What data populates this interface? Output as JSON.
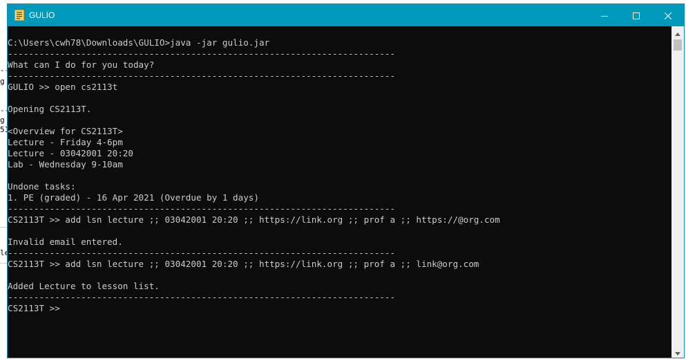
{
  "window": {
    "title": "GULIO"
  },
  "background_fragments": [
    "--",
    "g",
    "--",
    "g",
    "51",
    "le"
  ],
  "console": {
    "lines": [
      "C:\\Users\\cwh78\\Downloads\\GULIO>java -jar gulio.jar",
      "--------------------------------------------------------------------------",
      "What can I do for you today?",
      "--------------------------------------------------------------------------",
      "GULIO >> open cs2113t",
      "",
      "Opening CS2113T.",
      "",
      "<Overview for CS2113T>",
      "Lecture - Friday 4-6pm",
      "Lecture - 03042001 20:20",
      "Lab - Wednesday 9-10am",
      "",
      "Undone tasks:",
      "1. PE (graded) - 16 Apr 2021 (Overdue by 1 days)",
      "--------------------------------------------------------------------------",
      "CS2113T >> add lsn lecture ;; 03042001 20:20 ;; https://link.org ;; prof a ;; https://@org.com",
      "",
      "Invalid email entered.",
      "--------------------------------------------------------------------------",
      "CS2113T >> add lsn lecture ;; 03042001 20:20 ;; https://link.org ;; prof a ;; link@org.com",
      "",
      "Added Lecture to lesson list.",
      "--------------------------------------------------------------------------",
      "CS2113T >>"
    ]
  },
  "icons": {
    "app": "console-app-icon",
    "minimize": "minimize-icon",
    "maximize": "maximize-icon",
    "close": "close-icon",
    "scroll_up": "scroll-up-arrow-icon",
    "scroll_down": "scroll-down-arrow-icon"
  },
  "colors": {
    "titlebar": "#0099bc",
    "console_bg": "#0c0c0c",
    "console_text": "#cccccc"
  }
}
